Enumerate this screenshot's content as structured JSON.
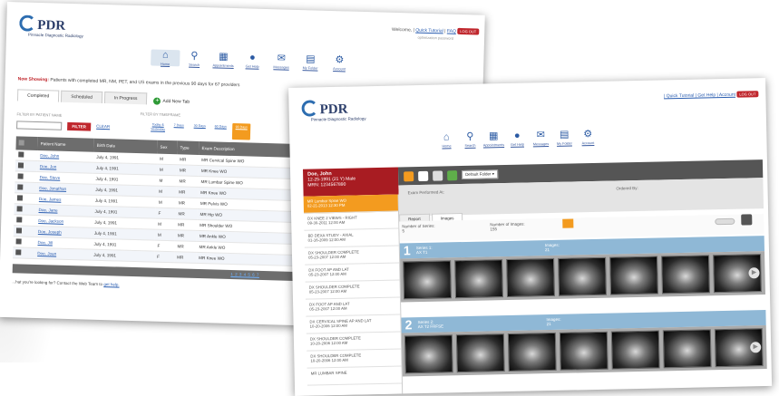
{
  "logo": {
    "title": "PDR",
    "subtitle": "Pinnacle Diagnostic Radiology"
  },
  "back": {
    "welcome_text": "Welcome, |",
    "quick_tutorial": "Quick Tutorial",
    "faq": "FAQ",
    "logout": "LOG OUT",
    "sub_text": "optimization password",
    "nav": [
      {
        "label": "Home",
        "icon": "home-icon",
        "active": true
      },
      {
        "label": "Search",
        "icon": "search-icon",
        "active": false
      },
      {
        "label": "Appointments",
        "icon": "calendar-icon",
        "active": false
      },
      {
        "label": "Get Help",
        "icon": "help-icon",
        "active": false
      },
      {
        "label": "Messages",
        "icon": "messages-icon",
        "active": false
      },
      {
        "label": "My Folder",
        "icon": "folder-icon",
        "active": false
      },
      {
        "label": "Account",
        "icon": "gear-icon",
        "active": false
      }
    ],
    "now_showing_label": "Now Showing:",
    "now_showing_text": "Patients with completed MR, NM, PET, and US exams in the previous 90 days for 67 providers",
    "tabs": [
      "Completed",
      "Scheduled",
      "In Progress"
    ],
    "add_tab": "Add New Tab",
    "filter_by_name": "FILTER BY PATIENT NAME",
    "filter_by_timeframe": "FILTER BY TIMEFRAME",
    "filter_button": "FILTER",
    "clear": "CLEAR",
    "timeframes": [
      {
        "label": "Today & Yesterday",
        "active": false
      },
      {
        "label": "7 Days",
        "active": false
      },
      {
        "label": "30 Days",
        "active": false
      },
      {
        "label": "60 Days",
        "active": false
      },
      {
        "label": "90 Days",
        "active": true
      }
    ],
    "columns": [
      "",
      "Patient Name",
      "Birth Date",
      "Sex",
      "Type",
      "Exam Description"
    ],
    "rows": [
      [
        "Doe, John",
        "July 4, 1991",
        "M",
        "MR",
        "MR Cervical Spine WO"
      ],
      [
        "Doe, Jon",
        "July 4, 1991",
        "M",
        "MR",
        "MR Knee WO"
      ],
      [
        "Doe, Steve",
        "July 4, 1991",
        "M",
        "MR",
        "MR Lumbar Spine WO"
      ],
      [
        "Doe, Jonathan",
        "July 4, 1991",
        "M",
        "MR",
        "MR Knee WO"
      ],
      [
        "Doe, James",
        "July 4, 1991",
        "M",
        "MR",
        "MR Pelvis WO"
      ],
      [
        "Doe, Jane",
        "July 4, 1991",
        "F",
        "MR",
        "MR Hip WO"
      ],
      [
        "Doe, Jackson",
        "July 4, 1991",
        "M",
        "MR",
        "MR Shoulder WO"
      ],
      [
        "Doe, Joseph",
        "July 4, 1991",
        "M",
        "MR",
        "MR Ankle WO"
      ],
      [
        "Doe, Jill",
        "July 4, 1991",
        "F",
        "MR",
        "MR Ankle WO"
      ],
      [
        "Doe, Joan",
        "July 4, 1991",
        "F",
        "MR",
        "MR Knee WO"
      ]
    ],
    "pager": "1 2 3 4 5 6 7",
    "footer_text": "...hat you're looking for? Contact the Web Team to",
    "footer_link": "get help."
  },
  "front": {
    "toplinks": "| Quick Tutorial | Get Help | Account",
    "logout": "LOG OUT",
    "nav": [
      {
        "label": "Home",
        "icon": "home-icon"
      },
      {
        "label": "Search",
        "icon": "search-icon"
      },
      {
        "label": "Appointments",
        "icon": "calendar-icon"
      },
      {
        "label": "Get Help",
        "icon": "help-icon"
      },
      {
        "label": "Messages",
        "icon": "messages-icon"
      },
      {
        "label": "My Folder",
        "icon": "folder-icon"
      },
      {
        "label": "Account",
        "icon": "gear-icon"
      }
    ],
    "patient": {
      "name": "Doe, John",
      "info": "12-25-1991 (21 Y) Male\nMRN: 1234567890"
    },
    "exams": [
      {
        "text": "MR Lumbar Spine WO\n02-21-2013 12:30 PM",
        "active": true
      },
      {
        "text": "DX KNEE 2 VIEWS - RIGHT\n09-30-2011 12:00 AM",
        "active": false
      },
      {
        "text": "BD DEXA STUDY - AXIAL\n01-16-2009 12:00 AM",
        "active": false
      },
      {
        "text": "DX SHOULDER COMPLETE\n05-23-2007 12:00 AM",
        "active": false
      },
      {
        "text": "DX FOOT AP AND LAT\n05-23-2007 12:00 AM",
        "active": false
      },
      {
        "text": "DX SHOULDER COMPLETE\n05-23-2007 12:00 AM",
        "active": false
      },
      {
        "text": "DX FOOT AP AND LAT\n05-23-2007 12:00 AM",
        "active": false
      },
      {
        "text": "DX CERVICAL SPINE AP AND LAT\n10-20-2006 12:00 AM",
        "active": false
      },
      {
        "text": "DX SHOULDER COMPLETE\n10-20-2006 12:00 AM",
        "active": false
      },
      {
        "text": "DX SHOULDER COMPLETE\n10-20-2006 12:00 AM",
        "active": false
      },
      {
        "text": "MR LUMBAR SPINE",
        "active": false
      }
    ],
    "folder_select": "Default Folder",
    "exam_performed": "Exam Performed At:",
    "ordered_by": "Ordered By:",
    "tabs": [
      "Report",
      "Images"
    ],
    "num_series_label": "Number of Series:",
    "num_series": "5",
    "num_images_label": "Number of Images:",
    "num_images": "155",
    "series": [
      {
        "number": "1",
        "label": "Series 1:",
        "desc": "AX T1",
        "images_label": "Images:",
        "images": "21"
      },
      {
        "number": "2",
        "label": "Series 2:",
        "desc": "AX T2 FRFSE",
        "images_label": "Images:",
        "images": "21"
      }
    ]
  }
}
